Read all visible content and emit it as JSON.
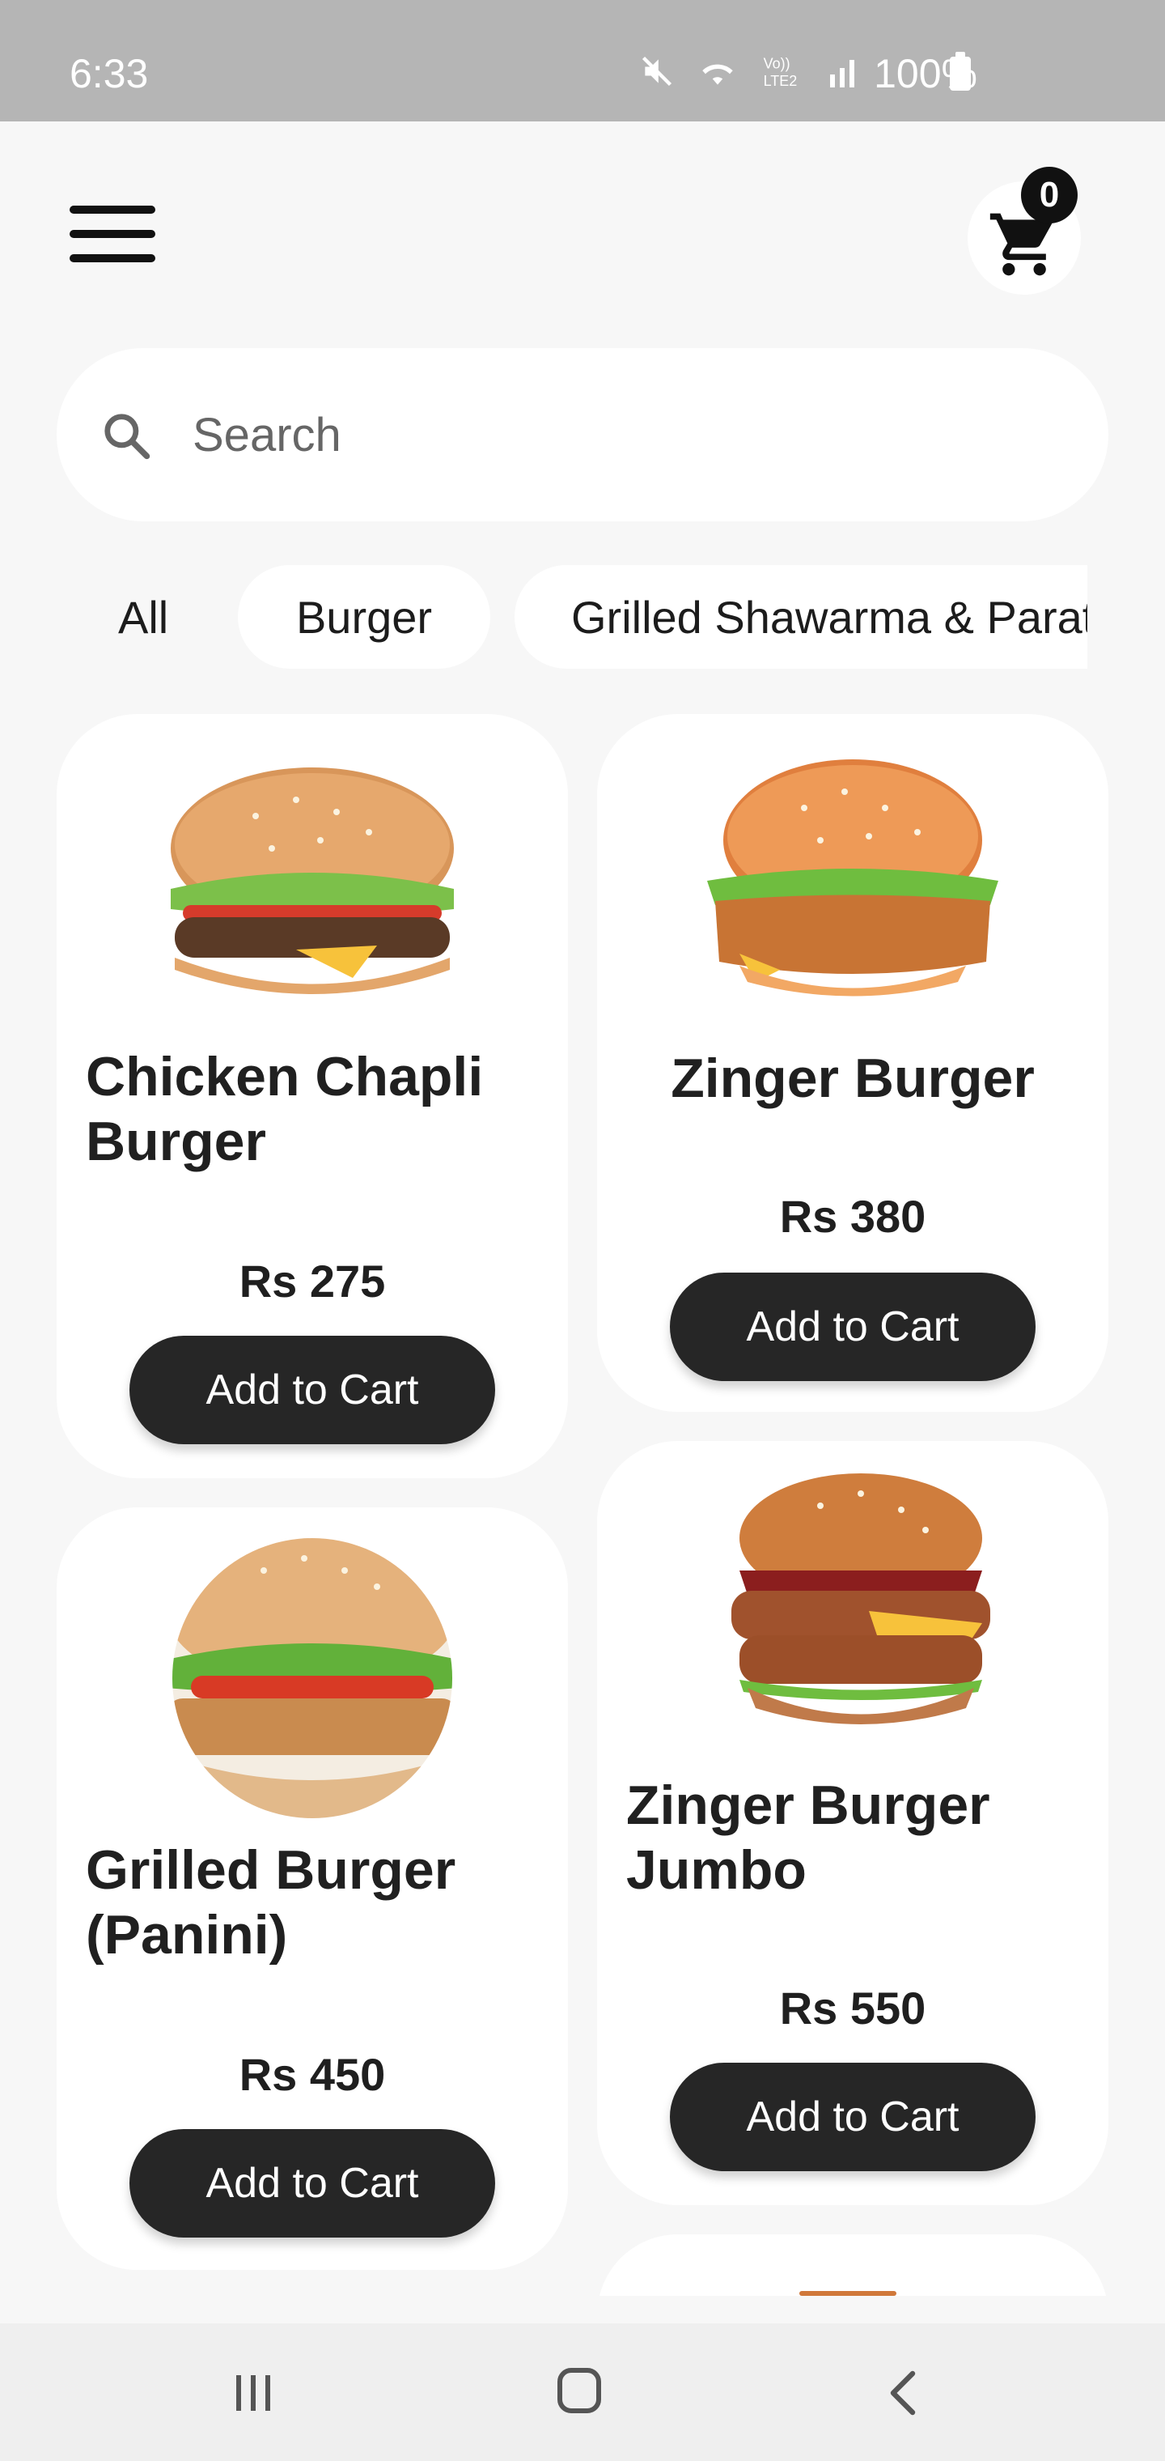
{
  "status_bar": {
    "time": "6:33",
    "battery": "100%",
    "icons": [
      "mute-icon",
      "wifi-icon",
      "volte-icon",
      "signal-icon",
      "battery-icon"
    ]
  },
  "header": {
    "menu_icon": "hamburger-menu-icon",
    "cart_icon": "shopping-cart-icon",
    "cart_count": "0"
  },
  "search": {
    "placeholder": "Search",
    "icon": "search-icon"
  },
  "categories": [
    {
      "label": "All",
      "active": true
    },
    {
      "label": "Burger",
      "active": false
    },
    {
      "label": "Grilled Shawarma & Paratha Roll",
      "active": false
    }
  ],
  "products": [
    {
      "name": "Chicken Chapli Burger",
      "price": "Rs 275",
      "button": "Add to Cart"
    },
    {
      "name": "Zinger Burger",
      "price": "Rs 380",
      "button": "Add to Cart"
    },
    {
      "name": "Grilled Burger (Panini)",
      "price": "Rs 450",
      "button": "Add to Cart"
    },
    {
      "name": "Zinger Burger Jumbo",
      "price": "Rs 550",
      "button": "Add to Cart"
    }
  ],
  "colors": {
    "background": "#f7f7f7",
    "card": "#ffffff",
    "button": "#262626",
    "button_text": "#ffffff",
    "status_bar": "#b5b5b5"
  },
  "nav_bar": {
    "recent": "recent-apps-icon",
    "home": "home-icon",
    "back": "back-icon"
  }
}
